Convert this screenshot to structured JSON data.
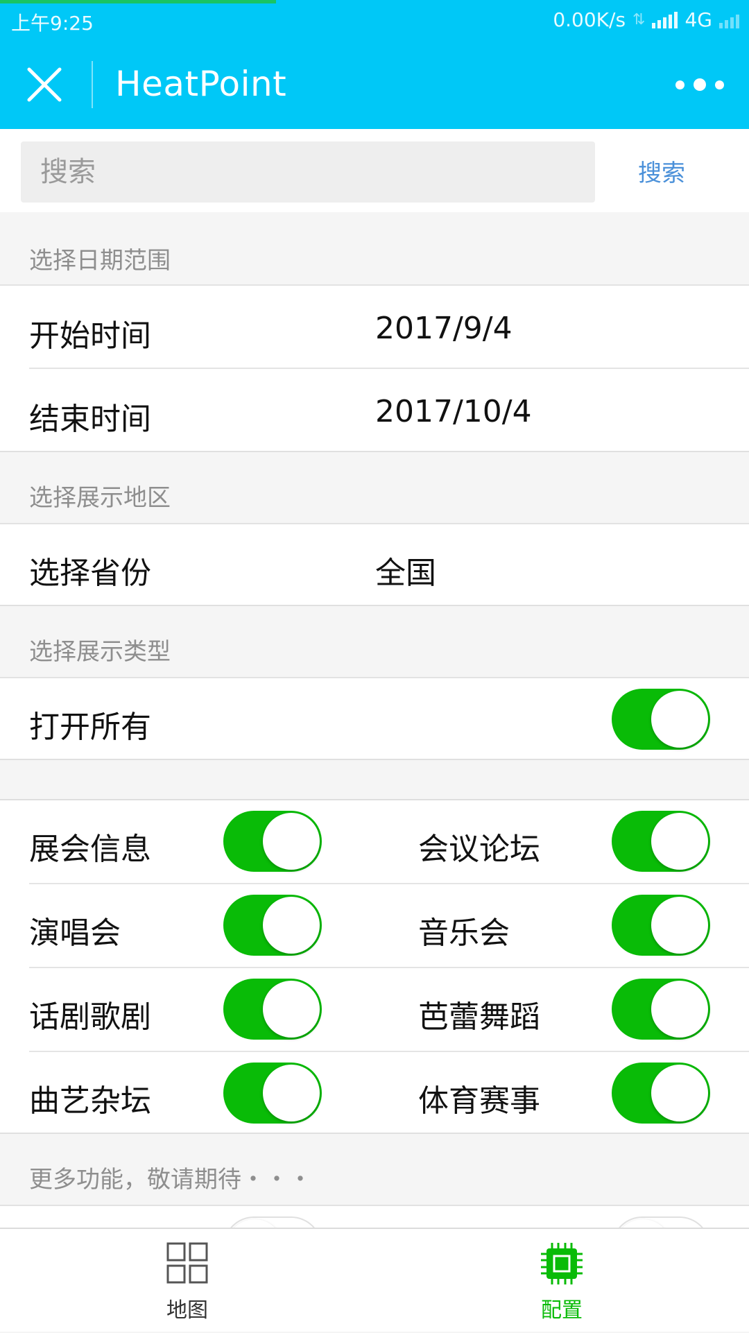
{
  "status_bar": {
    "time": "上午9:25",
    "net_speed": "0.00K/s",
    "network": "4G"
  },
  "title_bar": {
    "title": "HeatPoint"
  },
  "search": {
    "placeholder": "搜索",
    "button": "搜索"
  },
  "date_section": {
    "header": "选择日期范围",
    "start_label": "开始时间",
    "start_value": "2017/9/4",
    "end_label": "结束时间",
    "end_value": "2017/10/4"
  },
  "region_section": {
    "header": "选择展示地区",
    "province_label": "选择省份",
    "province_value": "全国"
  },
  "type_section": {
    "header": "选择展示类型",
    "open_all_label": "打开所有",
    "open_all_on": true,
    "items": [
      {
        "label": "展会信息",
        "on": true
      },
      {
        "label": "会议论坛",
        "on": true
      },
      {
        "label": "演唱会",
        "on": true
      },
      {
        "label": "音乐会",
        "on": true
      },
      {
        "label": "话剧歌剧",
        "on": true
      },
      {
        "label": "芭蕾舞蹈",
        "on": true
      },
      {
        "label": "曲艺杂坛",
        "on": true
      },
      {
        "label": "体育赛事",
        "on": true
      }
    ]
  },
  "more_section": {
    "header": "更多功能，敬请期待・・・"
  },
  "tab_bar": {
    "tabs": [
      {
        "label": "地图",
        "icon": "grid-icon",
        "active": false
      },
      {
        "label": "配置",
        "icon": "chip-icon",
        "active": true
      }
    ],
    "active_color": "#09bb07",
    "inactive_color": "#333333"
  },
  "colors": {
    "primary": "#00c8f7",
    "toggle_on": "#09bb07",
    "link": "#4a90d9"
  }
}
